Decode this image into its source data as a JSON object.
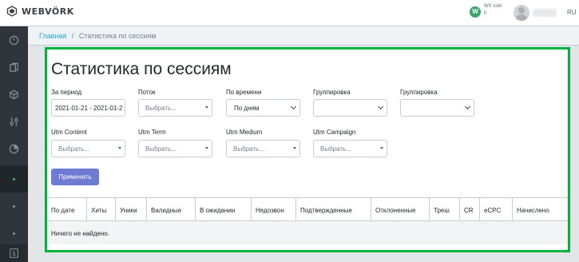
{
  "header": {
    "brand": "WEBVÖRK",
    "coin_symbol": "W",
    "coin_label": "WV coin",
    "coin_value": "0",
    "lang": "RU"
  },
  "sidebar": {
    "icons": [
      "speedometer-icon",
      "documents-icon",
      "cube-icon",
      "sliders-icon",
      "pie-chart-icon"
    ],
    "active_index": 5,
    "bottom_icon": "dollar-icon"
  },
  "breadcrumb": {
    "home": "Главная",
    "separator": "/",
    "current": "Статистика по сессиям"
  },
  "page": {
    "title": "Статистика по сессиям"
  },
  "filters": {
    "period": {
      "label": "За период",
      "value": "2021-01-21 - 2021-01-2"
    },
    "flow": {
      "label": "Поток",
      "placeholder": "Выбрать..."
    },
    "by_time": {
      "label": "По времени",
      "value": "По дням"
    },
    "grouping1": {
      "label": "Группировка",
      "value": ""
    },
    "grouping2": {
      "label": "Группировка",
      "value": ""
    },
    "utm_content": {
      "label": "Utm Content",
      "placeholder": "Выбрать..."
    },
    "utm_term": {
      "label": "Utm Term",
      "placeholder": "Выбрать..."
    },
    "utm_medium": {
      "label": "Utm Medium",
      "placeholder": "Выбрать..."
    },
    "utm_campaign": {
      "label": "Utm Campaign",
      "placeholder": "Выбрать..."
    }
  },
  "apply_label": "Применить",
  "table": {
    "columns": [
      "По дате",
      "Хиты",
      "Уники",
      "Валидные",
      "В ожидании",
      "Недозвон",
      "Подтвержденные",
      "Отклоненные",
      "Треш",
      "CR",
      "eCPC",
      "Начислено"
    ],
    "empty_message": "Ничего не найдено."
  },
  "colors": {
    "sidebar_bg": "#2f353a",
    "highlight_border": "#00b33c",
    "primary_button": "#6f7ad3",
    "link": "#20a8d8",
    "coin": "#3aa56b"
  }
}
